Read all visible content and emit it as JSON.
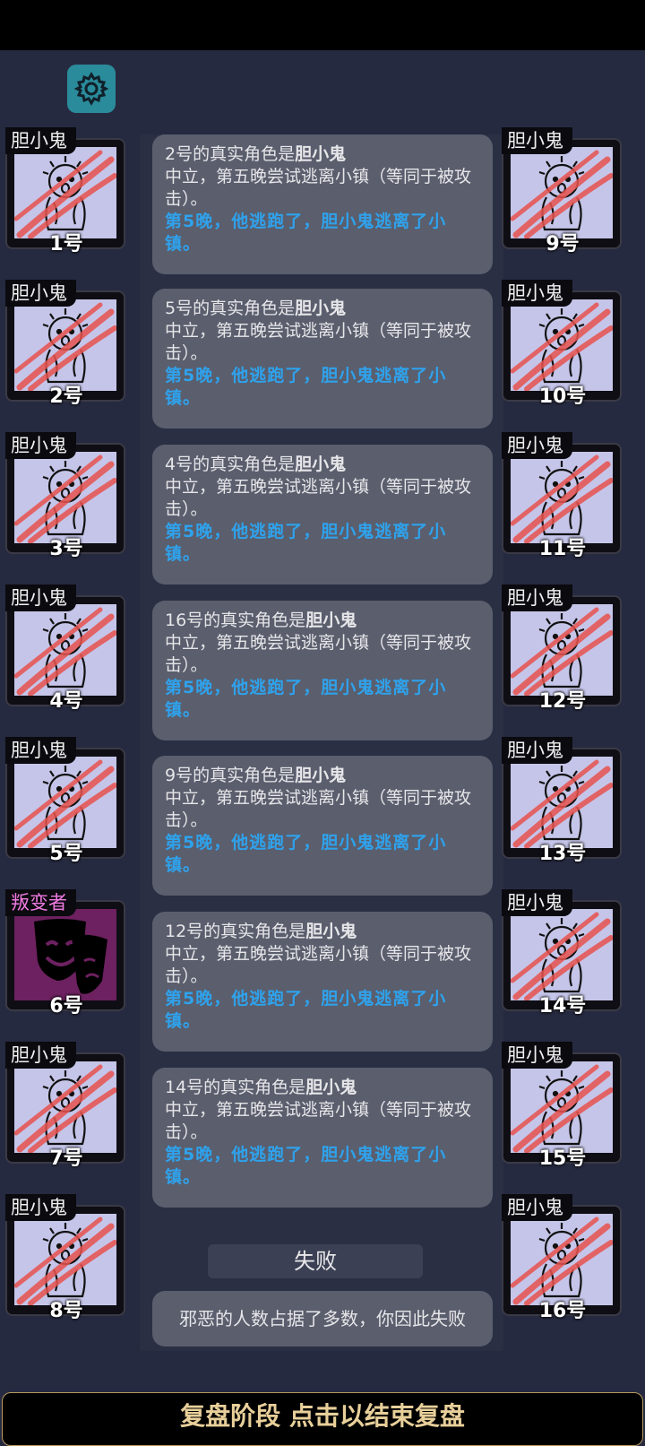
{
  "colors": {
    "background": "#262a40",
    "accent_blue": "#2fa2ec",
    "card": "#5a5e6d",
    "traitor_tag": "#f07ae0"
  },
  "settings_icon": "gear-icon",
  "left_players": [
    {
      "role": "胆小鬼",
      "num": "1号",
      "dead": true
    },
    {
      "role": "胆小鬼",
      "num": "2号",
      "dead": true
    },
    {
      "role": "胆小鬼",
      "num": "3号",
      "dead": true
    },
    {
      "role": "胆小鬼",
      "num": "4号",
      "dead": true
    },
    {
      "role": "胆小鬼",
      "num": "5号",
      "dead": true
    },
    {
      "role": "叛变者",
      "num": "6号",
      "dead": false
    },
    {
      "role": "胆小鬼",
      "num": "7号",
      "dead": true
    },
    {
      "role": "胆小鬼",
      "num": "8号",
      "dead": true
    }
  ],
  "right_players": [
    {
      "role": "胆小鬼",
      "num": "9号",
      "dead": true
    },
    {
      "role": "胆小鬼",
      "num": "10号",
      "dead": true
    },
    {
      "role": "胆小鬼",
      "num": "11号",
      "dead": true
    },
    {
      "role": "胆小鬼",
      "num": "12号",
      "dead": true
    },
    {
      "role": "胆小鬼",
      "num": "13号",
      "dead": true
    },
    {
      "role": "胆小鬼",
      "num": "14号",
      "dead": true
    },
    {
      "role": "胆小鬼",
      "num": "15号",
      "dead": true
    },
    {
      "role": "胆小鬼",
      "num": "16号",
      "dead": true
    }
  ],
  "log": [
    {
      "prefix": "2号的真实角色是",
      "role": "胆小鬼",
      "desc": "中立，第五晚尝试逃离小镇（等同于被攻击）。",
      "event": "第5晚，他逃跑了，胆小鬼逃离了小镇。"
    },
    {
      "prefix": "5号的真实角色是",
      "role": "胆小鬼",
      "desc": "中立，第五晚尝试逃离小镇（等同于被攻击）。",
      "event": "第5晚，他逃跑了，胆小鬼逃离了小镇。"
    },
    {
      "prefix": "4号的真实角色是",
      "role": "胆小鬼",
      "desc": "中立，第五晚尝试逃离小镇（等同于被攻击）。",
      "event": "第5晚，他逃跑了，胆小鬼逃离了小镇。"
    },
    {
      "prefix": "16号的真实角色是",
      "role": "胆小鬼",
      "desc": "中立，第五晚尝试逃离小镇（等同于被攻击）。",
      "event": "第5晚，他逃跑了，胆小鬼逃离了小镇。"
    },
    {
      "prefix": "9号的真实角色是",
      "role": "胆小鬼",
      "desc": "中立，第五晚尝试逃离小镇（等同于被攻击）。",
      "event": "第5晚，他逃跑了，胆小鬼逃离了小镇。"
    },
    {
      "prefix": "12号的真实角色是",
      "role": "胆小鬼",
      "desc": "中立，第五晚尝试逃离小镇（等同于被攻击）。",
      "event": "第5晚，他逃跑了，胆小鬼逃离了小镇。"
    },
    {
      "prefix": "14号的真实角色是",
      "role": "胆小鬼",
      "desc": "中立，第五晚尝试逃离小镇（等同于被攻击）。",
      "event": "第5晚，他逃跑了，胆小鬼逃离了小镇。"
    }
  ],
  "result": {
    "label": "失败",
    "message": "邪恶的人数占据了多数，你因此失败"
  },
  "footer": {
    "label": "复盘阶段 点击以结束复盘"
  }
}
